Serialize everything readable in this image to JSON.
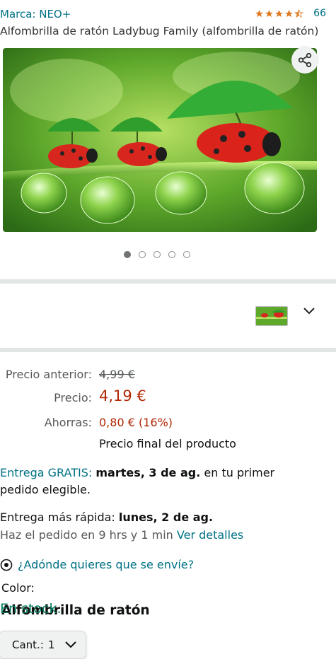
{
  "header": {
    "brand": "Marca: NEO+",
    "rating_value": 4.5,
    "rating_count": "66",
    "title": "Alfombrilla de ratón Ladybug Family (alfombrilla de ratón)"
  },
  "colors": {
    "link": "#007185",
    "price": "#b12704",
    "stock_green": "#067d62",
    "star": "#de7921"
  },
  "carousel": {
    "total_images": 5,
    "active_index": 0,
    "share_icon": "share-icon"
  },
  "color_selector": {
    "label": "Color:",
    "value": "Alfombrilla de ratón"
  },
  "pricing": {
    "previous_label": "Precio anterior:",
    "previous_value": "4,99 €",
    "price_label": "Precio:",
    "price_value": "4,19 €",
    "savings_label": "Ahorras:",
    "savings_value": "0,80 € (16%)",
    "final_note": "Precio final del producto"
  },
  "delivery": {
    "free_label": "Entrega GRATIS:",
    "free_date": "martes, 3 de ag.",
    "free_suffix": "en tu primer",
    "free_line2": "pedido elegible.",
    "fast_label": "Entrega más rápida:",
    "fast_date": "lunes, 2 de ag.",
    "order_within": "Haz el pedido en 9 hrs y 1 min",
    "details_link": "Ver detalles",
    "location_link": "¿Adónde quieres que se envíe?"
  },
  "stock": {
    "status": "En stock."
  },
  "quantity": {
    "label": "Cant.:",
    "value": "1"
  }
}
